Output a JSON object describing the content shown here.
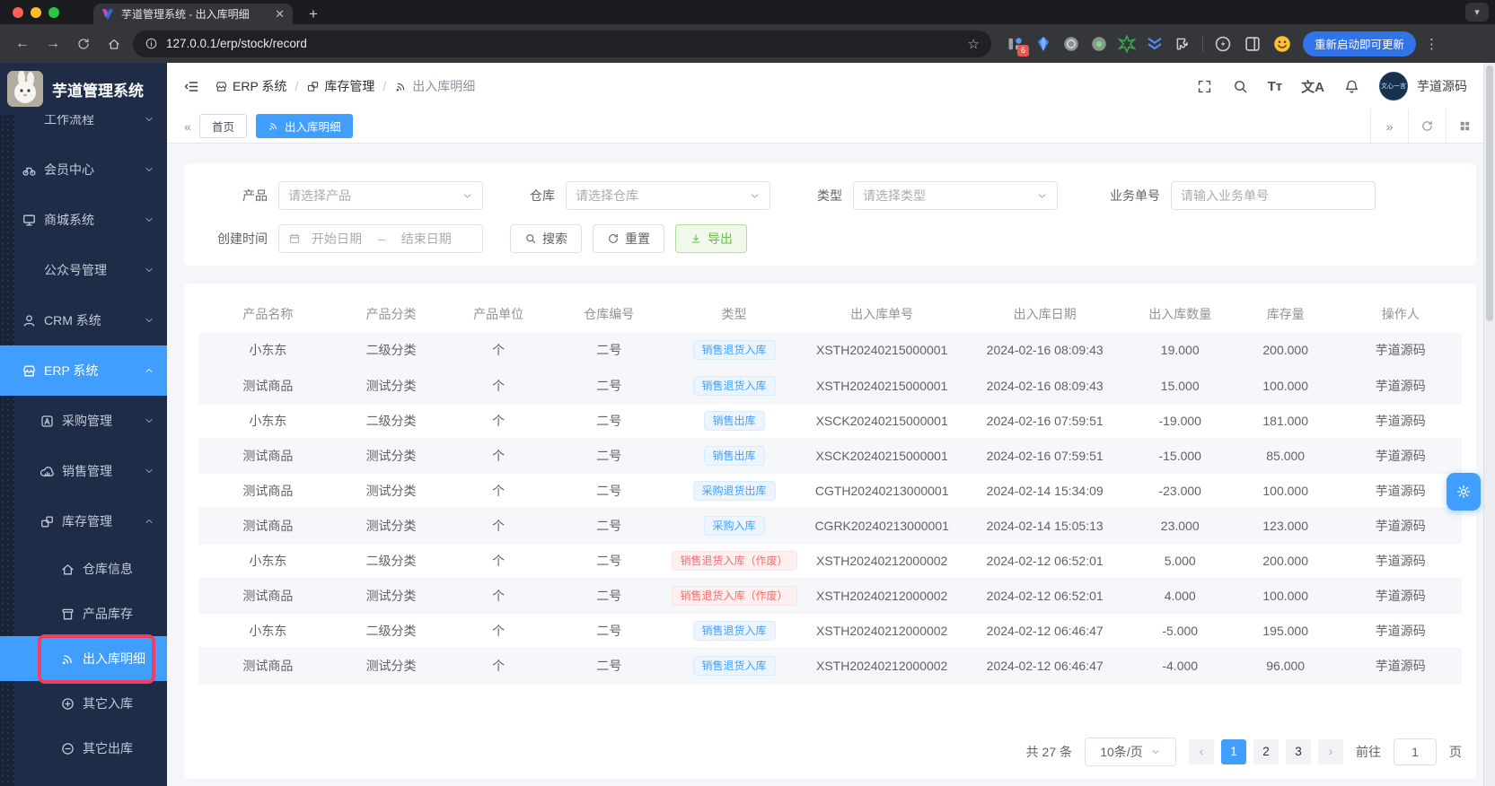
{
  "colors": {
    "primary": "#409eff",
    "success": "#67c23a",
    "danger": "#f56c6c",
    "annotation_box": "#ee3e63",
    "sidebar_bg": "#1e2c47"
  },
  "browser": {
    "tab_title": "芋道管理系统 - 出入库明细",
    "url": "127.0.0.1/erp/stock/record",
    "update_label": "重新启动即可更新",
    "ext_badge": "6"
  },
  "app": {
    "logo_title": "芋道管理系统",
    "username": "芋道源码",
    "avatar_text": "文心一言",
    "breadcrumb": [
      {
        "label": "ERP 系统",
        "icon": "store"
      },
      {
        "label": "库存管理",
        "icon": "boxes"
      },
      {
        "label": "出入库明细",
        "icon": "signal"
      }
    ],
    "tabs": [
      {
        "label": "首页",
        "active": false
      },
      {
        "label": "出入库明细",
        "active": true,
        "icon": "signal"
      }
    ]
  },
  "sidebar": {
    "items": [
      {
        "label": "工作流程",
        "icon": "",
        "level": 0,
        "chevron": "down"
      },
      {
        "label": "会员中心",
        "icon": "bike",
        "level": 0,
        "chevron": "down"
      },
      {
        "label": "商城系统",
        "icon": "monitor",
        "level": 0,
        "chevron": "down"
      },
      {
        "label": "公众号管理",
        "icon": "",
        "level": 0,
        "chevron": "down"
      },
      {
        "label": "CRM 系统",
        "icon": "user",
        "level": 0,
        "chevron": "down"
      },
      {
        "label": "ERP 系统",
        "icon": "store",
        "level": 0,
        "chevron": "up",
        "active": true
      },
      {
        "label": "采购管理",
        "icon": "asq",
        "level": 1,
        "chevron": "down"
      },
      {
        "label": "销售管理",
        "icon": "cloud",
        "level": 1,
        "chevron": "down"
      },
      {
        "label": "库存管理",
        "icon": "boxes",
        "level": 1,
        "chevron": "up"
      },
      {
        "label": "仓库信息",
        "icon": "home",
        "level": 2
      },
      {
        "label": "产品库存",
        "icon": "box",
        "level": 2
      },
      {
        "label": "出入库明细",
        "icon": "signal",
        "level": 2,
        "active": true,
        "annotated": true
      },
      {
        "label": "其它入库",
        "icon": "plus-circle",
        "level": 2
      },
      {
        "label": "其它出库",
        "icon": "minus-circle",
        "level": 2
      }
    ]
  },
  "filters": {
    "product_label": "产品",
    "product_placeholder": "请选择产品",
    "warehouse_label": "仓库",
    "warehouse_placeholder": "请选择仓库",
    "type_label": "类型",
    "type_placeholder": "请选择类型",
    "bizno_label": "业务单号",
    "bizno_placeholder": "请输入业务单号",
    "date_label": "创建时间",
    "date_start": "开始日期",
    "date_separator": "–",
    "date_end": "结束日期",
    "search_label": "搜索",
    "reset_label": "重置",
    "export_label": "导出"
  },
  "table": {
    "columns": [
      "产品名称",
      "产品分类",
      "产品单位",
      "仓库编号",
      "类型",
      "出入库单号",
      "出入库日期",
      "出入库数量",
      "库存量",
      "操作人"
    ],
    "rows": [
      {
        "name": "小东东",
        "category": "二级分类",
        "unit": "个",
        "warehouse": "二号",
        "type": "销售退货入库",
        "type_status": "primary",
        "order_no": "XSTH20240215000001",
        "datetime": "2024-02-16 08:09:43",
        "quantity": "19.000",
        "stock": "200.000",
        "operator": "芋道源码"
      },
      {
        "name": "测试商品",
        "category": "测试分类",
        "unit": "个",
        "warehouse": "二号",
        "type": "销售退货入库",
        "type_status": "primary",
        "order_no": "XSTH20240215000001",
        "datetime": "2024-02-16 08:09:43",
        "quantity": "15.000",
        "stock": "100.000",
        "operator": "芋道源码"
      },
      {
        "name": "小东东",
        "category": "二级分类",
        "unit": "个",
        "warehouse": "二号",
        "type": "销售出库",
        "type_status": "primary",
        "order_no": "XSCK20240215000001",
        "datetime": "2024-02-16 07:59:51",
        "quantity": "-19.000",
        "stock": "181.000",
        "operator": "芋道源码"
      },
      {
        "name": "测试商品",
        "category": "测试分类",
        "unit": "个",
        "warehouse": "二号",
        "type": "销售出库",
        "type_status": "primary",
        "order_no": "XSCK20240215000001",
        "datetime": "2024-02-16 07:59:51",
        "quantity": "-15.000",
        "stock": "85.000",
        "operator": "芋道源码"
      },
      {
        "name": "测试商品",
        "category": "测试分类",
        "unit": "个",
        "warehouse": "二号",
        "type": "采购退货出库",
        "type_status": "primary",
        "order_no": "CGTH20240213000001",
        "datetime": "2024-02-14 15:34:09",
        "quantity": "-23.000",
        "stock": "100.000",
        "operator": "芋道源码"
      },
      {
        "name": "测试商品",
        "category": "测试分类",
        "unit": "个",
        "warehouse": "二号",
        "type": "采购入库",
        "type_status": "primary",
        "order_no": "CGRK20240213000001",
        "datetime": "2024-02-14 15:05:13",
        "quantity": "23.000",
        "stock": "123.000",
        "operator": "芋道源码"
      },
      {
        "name": "小东东",
        "category": "二级分类",
        "unit": "个",
        "warehouse": "二号",
        "type": "销售退货入库（作废）",
        "type_status": "danger",
        "order_no": "XSTH20240212000002",
        "datetime": "2024-02-12 06:52:01",
        "quantity": "5.000",
        "stock": "200.000",
        "operator": "芋道源码"
      },
      {
        "name": "测试商品",
        "category": "测试分类",
        "unit": "个",
        "warehouse": "二号",
        "type": "销售退货入库（作废）",
        "type_status": "danger",
        "order_no": "XSTH20240212000002",
        "datetime": "2024-02-12 06:52:01",
        "quantity": "4.000",
        "stock": "100.000",
        "operator": "芋道源码"
      },
      {
        "name": "小东东",
        "category": "二级分类",
        "unit": "个",
        "warehouse": "二号",
        "type": "销售退货入库",
        "type_status": "primary",
        "order_no": "XSTH20240212000002",
        "datetime": "2024-02-12 06:46:47",
        "quantity": "-5.000",
        "stock": "195.000",
        "operator": "芋道源码"
      },
      {
        "name": "测试商品",
        "category": "测试分类",
        "unit": "个",
        "warehouse": "二号",
        "type": "销售退货入库",
        "type_status": "primary",
        "order_no": "XSTH20240212000002",
        "datetime": "2024-02-12 06:46:47",
        "quantity": "-4.000",
        "stock": "96.000",
        "operator": "芋道源码"
      }
    ]
  },
  "pagination": {
    "total": "共 27 条",
    "page_size": "10条/页",
    "pages": [
      "1",
      "2",
      "3"
    ],
    "active_page": "1",
    "goto_label": "前往",
    "goto_value": "1",
    "page_suffix": "页"
  }
}
